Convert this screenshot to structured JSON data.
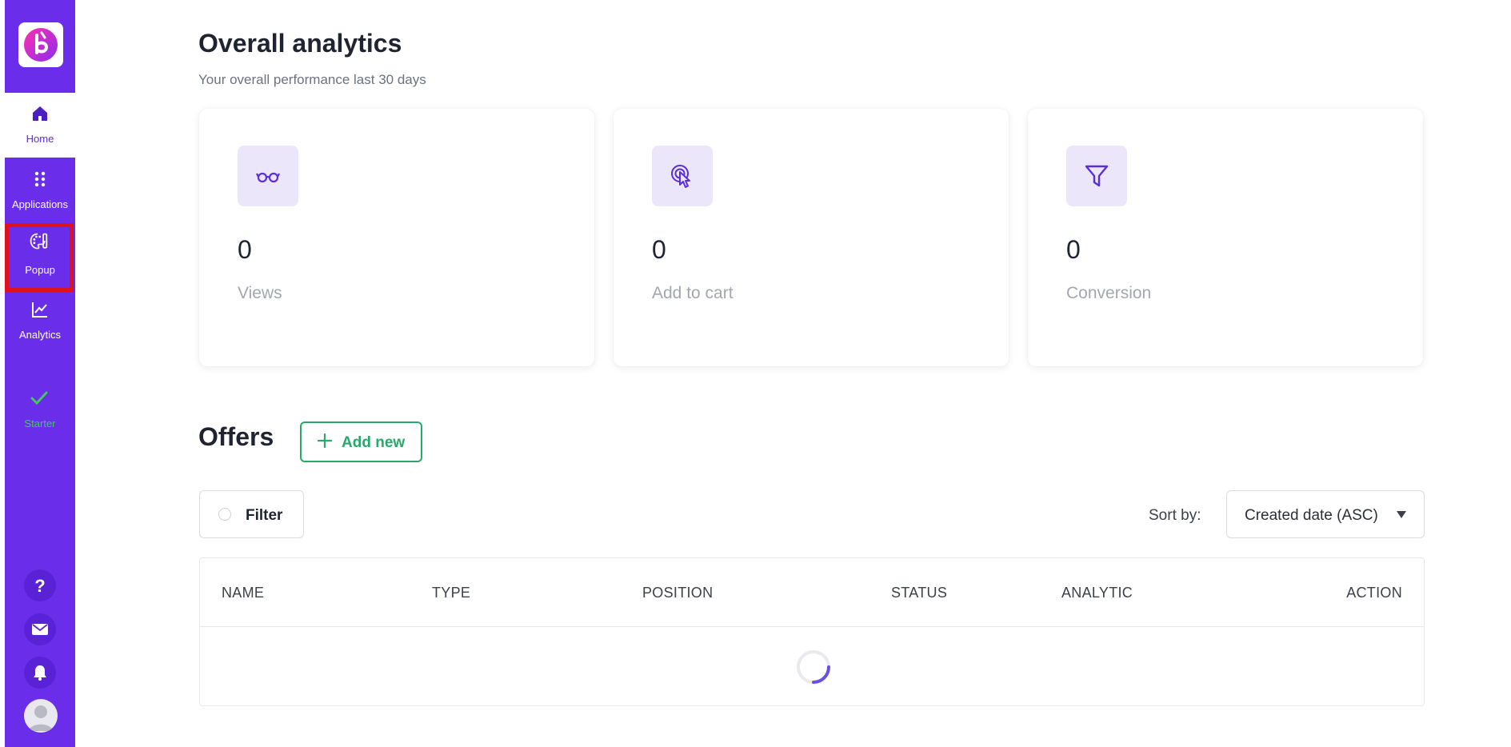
{
  "sidebar": {
    "items": [
      {
        "key": "home",
        "label": "Home",
        "icon": "home-icon"
      },
      {
        "key": "applications",
        "label": "Applications",
        "icon": "grid-dots-icon"
      },
      {
        "key": "popup",
        "label": "Popup",
        "icon": "palette-icon"
      },
      {
        "key": "analytics",
        "label": "Analytics",
        "icon": "chart-line-icon"
      }
    ],
    "plan": {
      "label": "Starter",
      "icon": "check-icon"
    },
    "bottom": [
      {
        "key": "help",
        "icon": "question-icon"
      },
      {
        "key": "mail",
        "icon": "mail-icon"
      },
      {
        "key": "notifications",
        "icon": "bell-icon"
      }
    ],
    "colors": {
      "background": "#6a2eea",
      "active_text": "#5b2ed6",
      "plan": "#41c85a",
      "highlight": "#e0101c"
    }
  },
  "main": {
    "title": "Overall analytics",
    "subtitle": "Your overall performance last 30 days",
    "stats": [
      {
        "value": "0",
        "label": "Views",
        "icon": "glasses-icon"
      },
      {
        "value": "0",
        "label": "Add to cart",
        "icon": "pointer-click-icon"
      },
      {
        "value": "0",
        "label": "Conversion",
        "icon": "funnel-icon"
      }
    ],
    "offers": {
      "title": "Offers",
      "add_new_label": "Add new",
      "filter_label": "Filter",
      "sort_label": "Sort by:",
      "sort_value": "Created date (ASC)",
      "columns": [
        "NAME",
        "TYPE",
        "POSITION",
        "STATUS",
        "ANALYTIC",
        "ACTION"
      ]
    },
    "colors": {
      "accent_green": "#28a86b",
      "icon_tint": "#5b2ed6",
      "icon_bg": "#ece6fb"
    }
  }
}
